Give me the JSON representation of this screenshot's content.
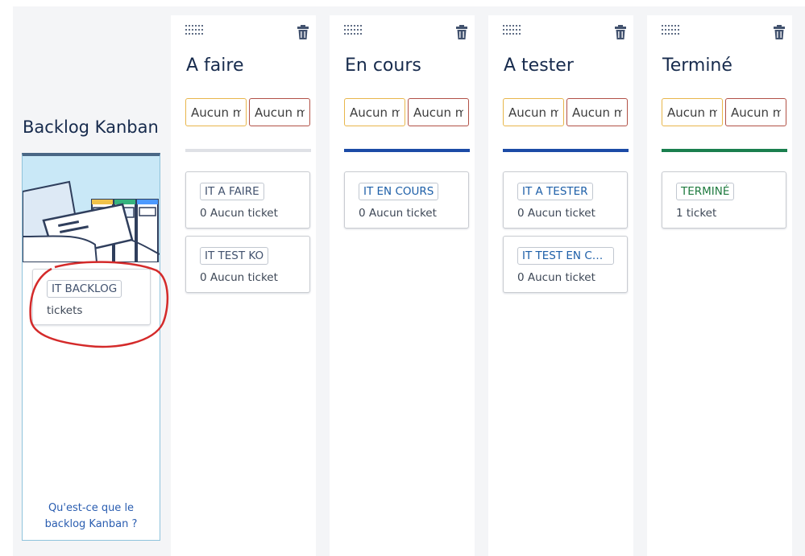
{
  "backlog": {
    "title": "Backlog Kanban",
    "card": {
      "status": "IT BACKLOG",
      "count": "tickets"
    },
    "help_line1": "Qu'est-ce que le",
    "help_line2": "backlog Kanban ?"
  },
  "columns": [
    {
      "title": "A faire",
      "min_placeholder": "Aucun m",
      "max_placeholder": "Aucun m",
      "bar_color": "#dfe1e6",
      "cards": [
        {
          "status": "IT A FAIRE",
          "count": "0 Aucun ticket"
        },
        {
          "status": "IT TEST KO",
          "count": "0 Aucun ticket"
        }
      ]
    },
    {
      "title": "En cours",
      "min_placeholder": "Aucun m",
      "max_placeholder": "Aucun m",
      "bar_color": "#1c4ba6",
      "cards": [
        {
          "status": "IT EN COURS",
          "count": "0 Aucun ticket"
        }
      ]
    },
    {
      "title": "A tester",
      "min_placeholder": "Aucun m",
      "max_placeholder": "Aucun m",
      "bar_color": "#1c4ba6",
      "cards": [
        {
          "status": "IT A TESTER",
          "count": "0 Aucun ticket"
        },
        {
          "status": "IT TEST EN COU...",
          "count": "0 Aucun ticket"
        }
      ]
    },
    {
      "title": "Terminé",
      "min_placeholder": "Aucun m",
      "max_placeholder": "Aucun m",
      "bar_color": "#1a7f4e",
      "cards": [
        {
          "status": "TERMINÉ",
          "count": "1 ticket"
        }
      ]
    }
  ],
  "colors": {
    "min_border": "#e8b64b",
    "max_border": "#b25146",
    "annotation_circle": "#d42a2a",
    "status_todo": "#42526e",
    "status_in_progress": "#1d5fa8",
    "status_done": "#1e7a3f"
  },
  "icons": [
    "drag-handle-icon",
    "trash-icon"
  ]
}
